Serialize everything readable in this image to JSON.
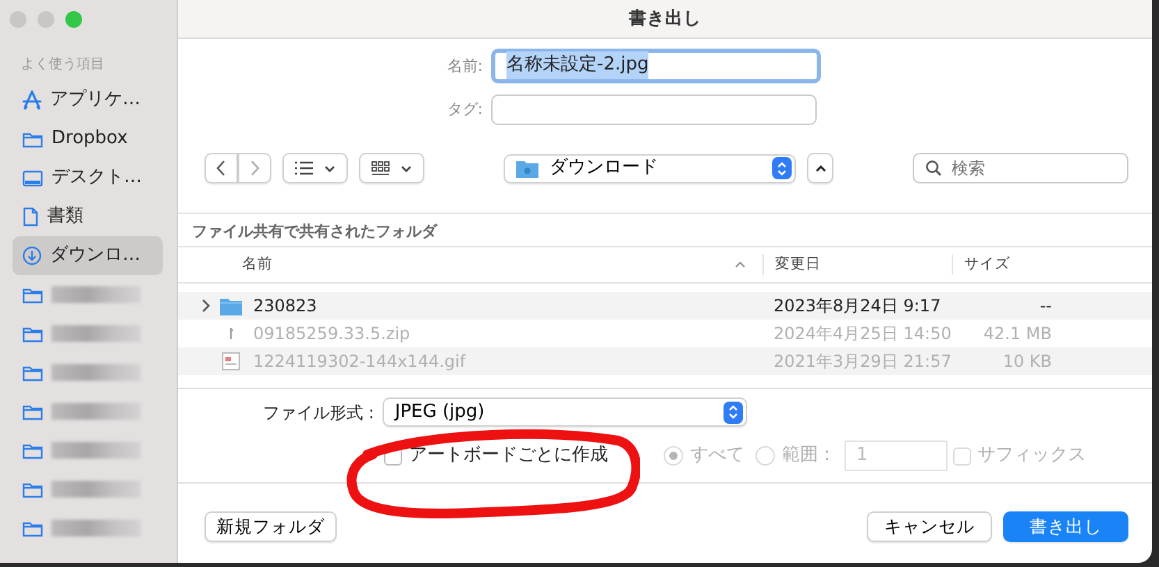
{
  "window": {
    "title": "書き出し"
  },
  "sidebar": {
    "heading": "よく使う項目",
    "items": [
      {
        "kind": "apps",
        "label": "アプリケ…",
        "selected": false
      },
      {
        "kind": "folder",
        "label": "Dropbox",
        "selected": false
      },
      {
        "kind": "desktop",
        "label": "デスクト…",
        "selected": false
      },
      {
        "kind": "document",
        "label": "書類",
        "selected": false
      },
      {
        "kind": "download",
        "label": "ダウンロ…",
        "selected": true
      },
      {
        "kind": "folder",
        "redacted": true,
        "selected": false
      },
      {
        "kind": "folder",
        "redacted": true,
        "selected": false
      },
      {
        "kind": "folder",
        "redacted": true,
        "selected": false
      },
      {
        "kind": "folder",
        "redacted": true,
        "selected": false
      },
      {
        "kind": "folder",
        "redacted": true,
        "selected": false
      },
      {
        "kind": "folder",
        "redacted": true,
        "selected": false
      },
      {
        "kind": "folder",
        "redacted": true,
        "selected": false
      }
    ]
  },
  "name_field": {
    "label": "名前:",
    "value": "名称未設定-2.jpg"
  },
  "tag_field": {
    "label": "タグ:"
  },
  "toolbar": {
    "location": "ダウンロード",
    "search": {
      "placeholder": "検索"
    }
  },
  "section_title": "ファイル共有で共有されたフォルダ",
  "table": {
    "columns": [
      {
        "label": "名前",
        "sorted": true
      },
      {
        "label": "変更日",
        "sorted": false
      },
      {
        "label": "サイズ",
        "sorted": false
      }
    ],
    "rows": [
      {
        "kind": "folder",
        "name": "230823",
        "date": "2023年8月24日 9:17",
        "size": "--",
        "disabled": false
      },
      {
        "kind": "zip",
        "name": "09185259.33.5.zip",
        "date": "2024年4月25日 14:50",
        "size": "42.1 MB",
        "disabled": true
      },
      {
        "kind": "image",
        "name": "1224119302-144x144.gif",
        "date": "2021年3月29日 21:57",
        "size": "10 KB",
        "disabled": true
      }
    ]
  },
  "format": {
    "label": "ファイル形式 :",
    "value": "JPEG (jpg)"
  },
  "options": [
    {
      "kind": "checkbox",
      "label": "アートボードごとに作成",
      "checked": false,
      "disabled": false
    },
    {
      "kind": "radio",
      "label": "すべて",
      "checked": true,
      "disabled": true
    },
    {
      "kind": "radio",
      "label": "範囲 :",
      "checked": false,
      "disabled": true
    },
    {
      "kind": "field",
      "value": "1",
      "disabled": true
    },
    {
      "kind": "checkbox",
      "label": "サフィックス",
      "checked": false,
      "disabled": true
    }
  ],
  "buttons": [
    {
      "label": "新規フォルダ",
      "kind": "secondary"
    },
    {
      "label": "キャンセル",
      "kind": "secondary"
    },
    {
      "label": "書き出し",
      "kind": "primary"
    }
  ],
  "annotations": [
    {
      "kind": "ellipse"
    }
  ]
}
